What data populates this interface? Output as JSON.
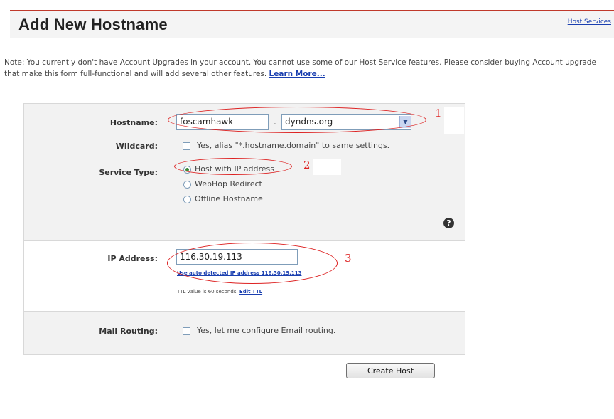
{
  "page": {
    "title": "Add New Hostname",
    "host_services_link": "Host Services",
    "note_text": "Note: You currently don't have Account Upgrades in your account. You cannot use some of our Host Service features. Please consider buying Account upgrade that make this form full-functional and will add several other features. ",
    "learn_more": "Learn More..."
  },
  "form": {
    "hostname_label": "Hostname:",
    "hostname_value": "foscamhawk",
    "hostname_dot": ".",
    "domain_value": "dyndns.org",
    "wildcard_label": "Wildcard:",
    "wildcard_text": "Yes, alias \"*.hostname.domain\" to same settings.",
    "service_type_label": "Service Type:",
    "service_options": [
      "Host with IP address",
      "WebHop Redirect",
      "Offline Hostname"
    ],
    "ip_label": "IP Address:",
    "ip_value": "116.30.19.113",
    "auto_ip_link": "Use auto detected IP address 116.30.19.113",
    "ttl_text": "TTL value is 60 seconds. ",
    "edit_ttl_link": "Edit TTL",
    "mail_label": "Mail Routing:",
    "mail_text": "Yes, let me configure Email routing.",
    "create_button": "Create Host"
  },
  "annotations": {
    "one": "1",
    "two": "2",
    "three": "3"
  },
  "icons": {
    "help": "help-icon",
    "dropdown": "chevron-down-icon"
  },
  "colors": {
    "header_rule": "#c0392b",
    "link": "#1a3fb0",
    "annotation": "#dd2222"
  }
}
